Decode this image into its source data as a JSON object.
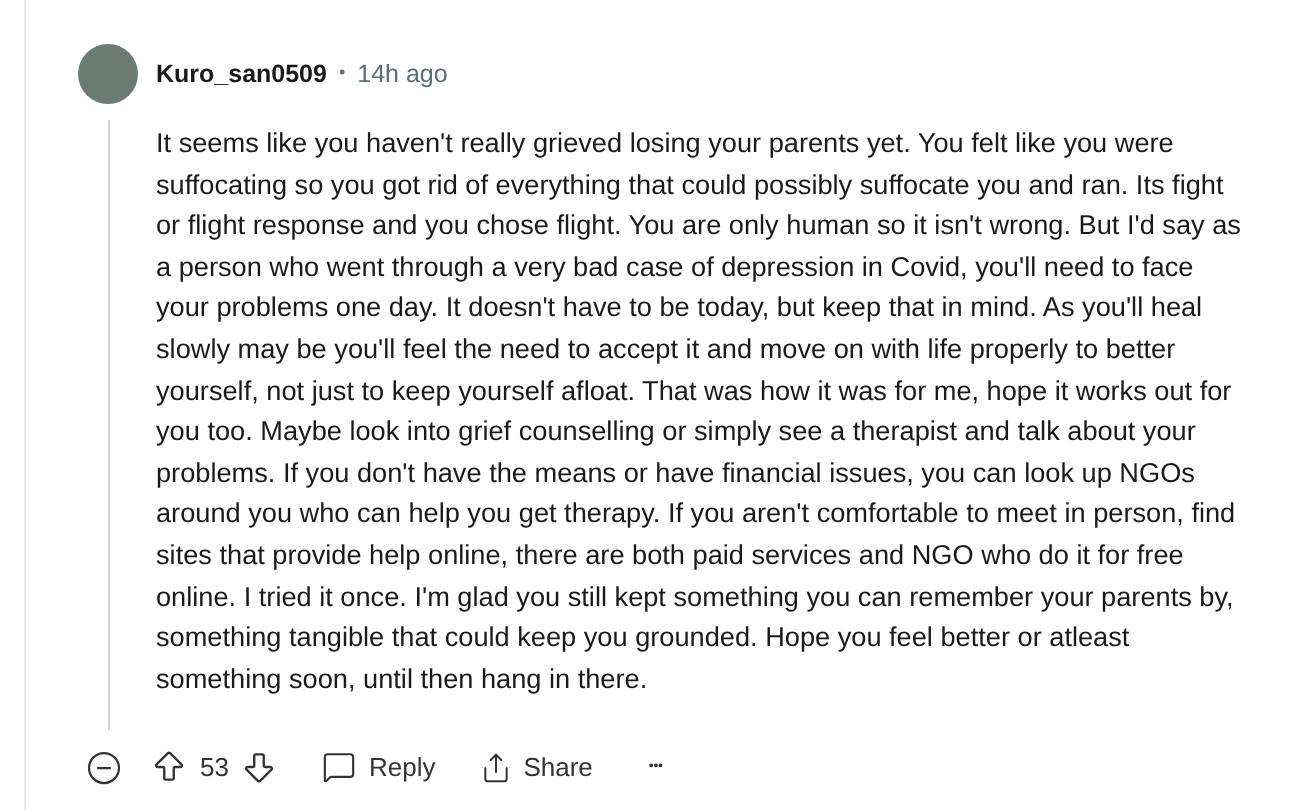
{
  "comment": {
    "author": "Kuro_san0509",
    "separator": "•",
    "time": "14h ago",
    "body": "It seems like you haven't really grieved losing your parents yet. You felt like you were suffocating so you got rid of everything that could possibly suffocate you and ran. Its fight or flight response and you chose flight. You are only human so it isn't wrong. But I'd say as a person who went through a very bad case of depression in Covid, you'll need to face your problems one day. It doesn't have to be today, but keep that in mind. As you'll heal slowly may be you'll feel the need to accept it and move on with life properly to better yourself, not just to keep yourself afloat. That was how it was for me, hope it works out for you too. Maybe look into grief counselling or simply see a therapist and talk about your problems. If you don't have the means or have financial issues, you can look up NGOs around you who can help you get therapy. If you aren't comfortable to meet in person, find sites that provide help online, there are both paid services and NGO who do it for free online. I tried it once. I'm glad you still kept something you can remember your parents by, something tangible that could keep you grounded. Hope you feel better or atleast something soon, until then hang in there.",
    "score": "53",
    "actions": [
      "Reply",
      "Share"
    ],
    "more": "•••"
  }
}
